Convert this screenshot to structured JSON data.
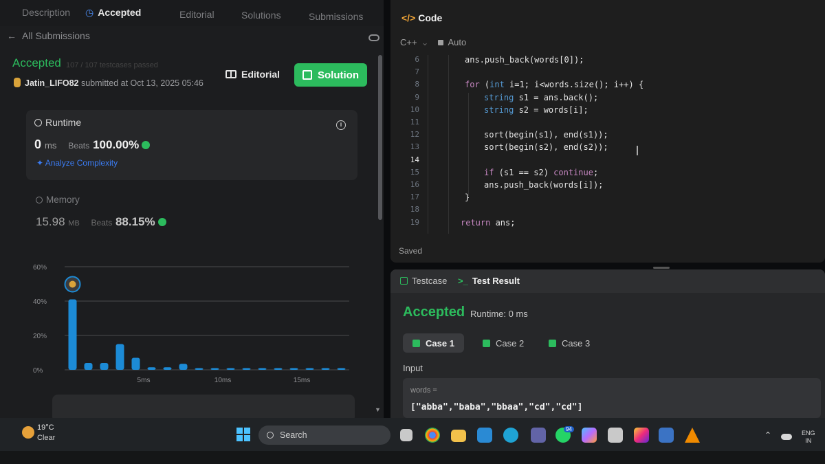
{
  "left": {
    "tabs": {
      "description": "Description",
      "accepted": "Accepted",
      "editorial": "Editorial",
      "solutions": "Solutions",
      "submissions": "Submissions"
    },
    "back_label": "All Submissions",
    "status": "Accepted",
    "testcases_text": "107 / 107 testcases passed",
    "username": "Jatin_LIFO82",
    "submitted_text": "submitted at Oct 13, 2025 05:46",
    "editorial_button": "Editorial",
    "solution_button": "Solution",
    "runtime": {
      "label": "Runtime",
      "value": "0",
      "unit": "ms",
      "beats_label": "Beats",
      "beats_value": "100.00%",
      "analyze": "Analyze Complexity"
    },
    "memory": {
      "label": "Memory",
      "value": "15.98",
      "unit": "MB",
      "beats_label": "Beats",
      "beats_value": "88.15%"
    }
  },
  "chart_data": {
    "type": "bar",
    "y_ticks": [
      "60%",
      "40%",
      "20%",
      "0%"
    ],
    "ylim": [
      0,
      60
    ],
    "x_ticks": [
      "5ms",
      "10ms",
      "15ms"
    ],
    "x_tick_positions": [
      5,
      10,
      15
    ],
    "x": [
      0,
      1,
      2,
      3,
      4,
      5,
      6,
      7,
      8,
      9,
      10,
      11,
      12,
      13,
      14,
      15,
      16,
      17
    ],
    "values": [
      41,
      4,
      4,
      15,
      7,
      1.5,
      1.5,
      3.5,
      1,
      1,
      1,
      1,
      1,
      1,
      1,
      1,
      1,
      1
    ],
    "colors": {
      "bar": "#1c8bd6",
      "grid": "#4a4b4e",
      "tick": "#8d8e91"
    },
    "highlight_index": 0
  },
  "code": {
    "title": "Code",
    "language": "C++",
    "mode": "Auto",
    "lines": [
      {
        "n": "6",
        "indent": 0,
        "text": "ans.push_back(words[0]);"
      },
      {
        "n": "7",
        "indent": 0,
        "text": ""
      },
      {
        "n": "8",
        "indent": 0,
        "text": "for (int i=1; i<words.size(); i++) {"
      },
      {
        "n": "9",
        "indent": 1,
        "text": "string s1 = ans.back();"
      },
      {
        "n": "10",
        "indent": 1,
        "text": "string s2 = words[i];"
      },
      {
        "n": "11",
        "indent": 0,
        "text": ""
      },
      {
        "n": "12",
        "indent": 1,
        "text": "sort(begin(s1), end(s1));"
      },
      {
        "n": "13",
        "indent": 1,
        "text": "sort(begin(s2), end(s2));"
      },
      {
        "n": "14",
        "indent": 0,
        "text": ""
      },
      {
        "n": "15",
        "indent": 1,
        "text": "if (s1 == s2) continue;"
      },
      {
        "n": "16",
        "indent": 1,
        "text": "ans.push_back(words[i]);"
      },
      {
        "n": "17",
        "indent": 0,
        "text": "}"
      },
      {
        "n": "18",
        "indent": 0,
        "text": ""
      },
      {
        "n": "19",
        "indent": 0,
        "text": "return ans;"
      }
    ],
    "current_line": "14",
    "status": "Saved"
  },
  "test": {
    "tab_testcase": "Testcase",
    "tab_result": "Test Result",
    "status": "Accepted",
    "runtime": "Runtime: 0 ms",
    "cases": [
      "Case 1",
      "Case 2",
      "Case 3"
    ],
    "input_label": "Input",
    "var_label": "words =",
    "var_value": "[\"abba\",\"baba\",\"bbaa\",\"cd\",\"cd\"]"
  },
  "taskbar": {
    "temperature": "19°C",
    "condition": "Clear",
    "search_placeholder": "Search",
    "whatsapp_badge": "94",
    "language_line1": "ENG",
    "language_line2": "IN",
    "icons": [
      "start-icon",
      "search-icon",
      "file-icon",
      "chrome-icon",
      "folder-icon",
      "vscode-icon",
      "edge-icon",
      "teams-icon",
      "whatsapp-icon",
      "copilot-icon",
      "store-icon",
      "instagram-icon",
      "app-icon",
      "vlc-icon"
    ]
  }
}
